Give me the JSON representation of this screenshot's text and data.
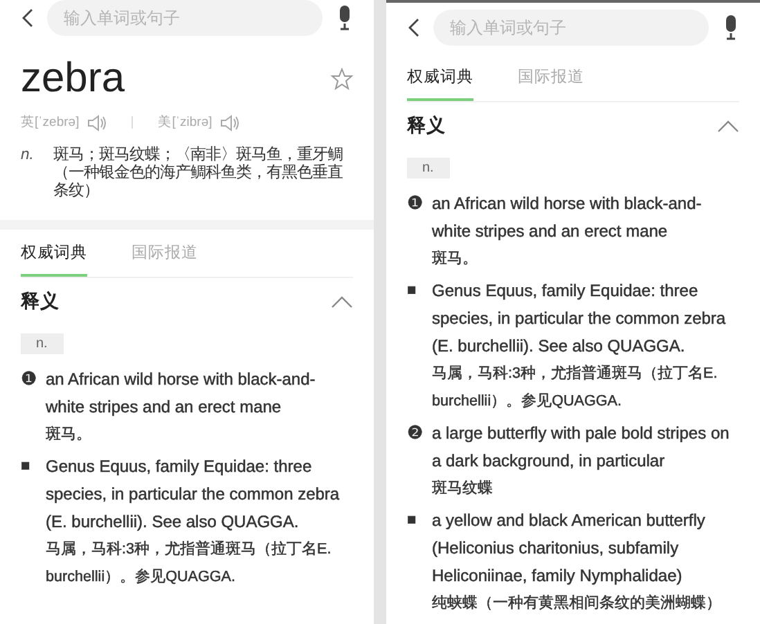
{
  "panels": [
    {
      "search": {
        "placeholder": "输入单词或句子"
      },
      "word": {
        "headword": "zebra",
        "starred": false,
        "pronunciations": [
          {
            "label": "英[ˈzebrə]"
          },
          {
            "label": "美[ˈzibrə]"
          }
        ],
        "definitions": [
          {
            "pos": "n.",
            "text": "斑马；斑马纹蝶；〈南非〉斑马鱼，重牙鲷（一种银金色的海产鲷科鱼类，有黑色垂直条纹）"
          }
        ]
      },
      "tabs": [
        {
          "label": "权威词典",
          "selected": true
        },
        {
          "label": "国际报道",
          "selected": false
        }
      ],
      "section": {
        "title": "释义",
        "expanded": true
      },
      "pos_tag": "n.",
      "senses": [
        {
          "kind": "numbered",
          "marker": "❶",
          "english": "an African wild horse with black-and-white stripes and an erect mane",
          "chinese": "斑马。"
        },
        {
          "kind": "bullet",
          "marker": "■",
          "english": "Genus Equus, family Equidae: three species, in particular the common zebra (E. burchellii). See also QUAGGA.",
          "chinese": "马属，马科:3种，尤指普通斑马（拉丁名E. burchellii）。参见QUAGGA."
        }
      ]
    },
    {
      "search": {
        "placeholder": "输入单词或句子"
      },
      "tabs": [
        {
          "label": "权威词典",
          "selected": true
        },
        {
          "label": "国际报道",
          "selected": false
        }
      ],
      "section": {
        "title": "释义",
        "expanded": true
      },
      "pos_tag": "n.",
      "senses": [
        {
          "kind": "numbered",
          "marker": "❶",
          "english": "an African wild horse with black-and-white stripes and an erect mane",
          "chinese": "斑马。"
        },
        {
          "kind": "bullet",
          "marker": "■",
          "english": "Genus Equus, family Equidae: three species, in particular the common zebra (E. burchellii). See also QUAGGA.",
          "chinese": "马属，马科:3种，尤指普通斑马（拉丁名E. burchellii）。参见QUAGGA."
        },
        {
          "kind": "numbered",
          "marker": "❷",
          "english": "a large butterfly with pale bold stripes on a dark background, in particular",
          "chinese": "斑马纹蝶"
        },
        {
          "kind": "bullet",
          "marker": "■",
          "english": "a yellow and black American butterfly (Heliconius charitonius, subfamily Heliconiinae, family Nymphalidae)",
          "chinese": "纯蛱蝶（一种有黄黑相间条纹的美洲蝴蝶）"
        }
      ]
    }
  ]
}
